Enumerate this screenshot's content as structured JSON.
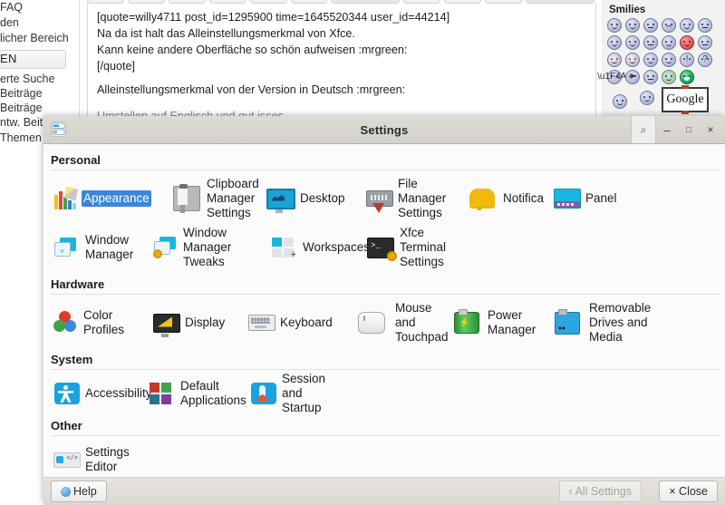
{
  "background": {
    "sidebar_lines": [
      "FAQ",
      "den",
      "licher Bereich",
      "erte Suche",
      " Beiträge",
      "Beiträge",
      "ntw. Beiträ",
      "Themen"
    ],
    "sidebar_pill_label": "EN",
    "editor_lines": [
      "[quote=willy4711 post_id=1295900 time=1645520344 user_id=44214]",
      "Na da ist halt das Alleinstellungsmerkmal von Xfce.",
      "Kann keine andere Oberfläche so schön aufweisen  :mrgreen:",
      "[/quote]",
      "Alleinstellungsmerkmal von der Version in Deutsch  :mrgreen:",
      "Umstellen auf Englisch und gut isses"
    ],
    "smilies_title": "Smilies",
    "google_label": "Google"
  },
  "window": {
    "title": "Settings",
    "icon": "settings-icon",
    "titlebar_buttons": [
      {
        "name": "search-icon",
        "glyph": "⌕"
      },
      {
        "name": "minimize-icon",
        "glyph": "–"
      },
      {
        "name": "maximize-icon",
        "glyph": "□"
      },
      {
        "name": "close-icon",
        "glyph": "×"
      }
    ]
  },
  "sections": [
    {
      "title": "Personal",
      "items": [
        {
          "label": "Appearance",
          "icon": "appearance-icon",
          "selected": true
        },
        {
          "label": "Clipboard Manager Settings",
          "icon": "clipboard-manager-icon",
          "selected": false
        },
        {
          "label": "Desktop",
          "icon": "desktop-icon",
          "selected": false
        },
        {
          "label": "File Manager Settings",
          "icon": "file-manager-icon",
          "selected": false
        },
        {
          "label": "Notifications",
          "icon": "notifications-icon",
          "selected": false
        },
        {
          "label": "Panel",
          "icon": "panel-icon",
          "selected": false
        },
        {
          "label": "Window Manager",
          "icon": "window-manager-icon",
          "selected": false
        },
        {
          "label": "Window Manager Tweaks",
          "icon": "window-manager-tweaks-icon",
          "selected": false
        },
        {
          "label": "Workspaces",
          "icon": "workspaces-icon",
          "selected": false
        },
        {
          "label": "Xfce Terminal Settings",
          "icon": "xfce-terminal-icon",
          "selected": false
        }
      ]
    },
    {
      "title": "Hardware",
      "items": [
        {
          "label": "Color Profiles",
          "icon": "color-profiles-icon",
          "selected": false
        },
        {
          "label": "Display",
          "icon": "display-icon",
          "selected": false
        },
        {
          "label": "Keyboard",
          "icon": "keyboard-icon",
          "selected": false
        },
        {
          "label": "Mouse and Touchpad",
          "icon": "mouse-icon",
          "selected": false
        },
        {
          "label": "Power Manager",
          "icon": "power-manager-icon",
          "selected": false
        },
        {
          "label": "Removable Drives and Media",
          "icon": "removable-drives-icon",
          "selected": false
        }
      ]
    },
    {
      "title": "System",
      "items": [
        {
          "label": "Accessibility",
          "icon": "accessibility-icon",
          "selected": false
        },
        {
          "label": "Default Applications",
          "icon": "default-applications-icon",
          "selected": false
        },
        {
          "label": "Session and Startup",
          "icon": "session-startup-icon",
          "selected": false
        }
      ]
    },
    {
      "title": "Other",
      "items": [
        {
          "label": "Settings Editor",
          "icon": "settings-editor-icon",
          "selected": false
        }
      ]
    }
  ],
  "buttonbar": {
    "help": "Help",
    "all_settings": "‹ All Settings",
    "close": "× Close",
    "all_settings_disabled": true
  },
  "colors": {
    "selection_blue": "#3a86d8",
    "titlebar": "#d9d6d0",
    "content_bg": "#fbfbfb"
  }
}
